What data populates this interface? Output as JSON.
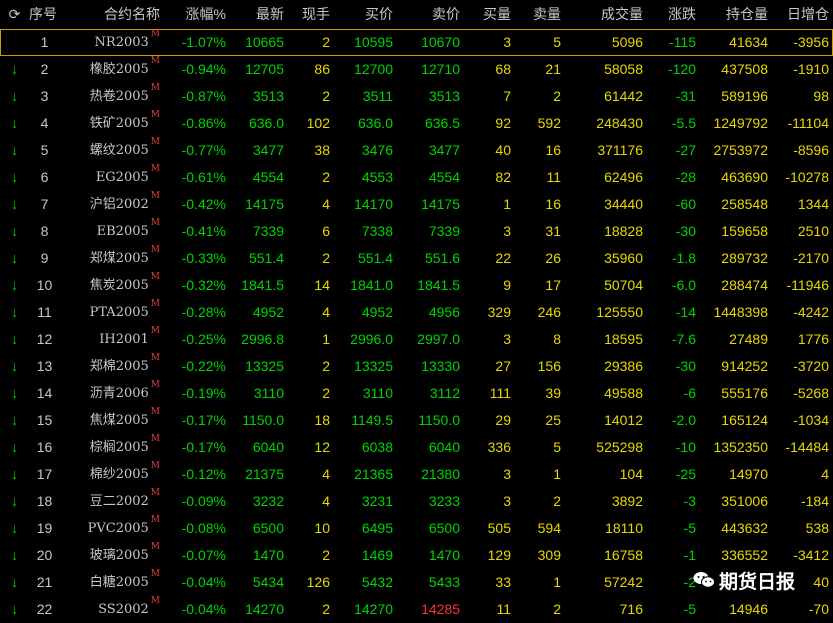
{
  "header": {
    "refresh_glyph": "⟳",
    "columns": [
      "序号",
      "合约名称",
      "涨幅%",
      "最新",
      "现手",
      "买价",
      "卖价",
      "买量",
      "卖量",
      "成交量",
      "涨跌",
      "持仓量",
      "日增仓"
    ]
  },
  "rows": [
    {
      "seq": "1",
      "name": "NR2003",
      "flag": "M",
      "pct": "-1.07%",
      "last": "10665",
      "hand": "2",
      "bid": "10595",
      "ask": "10670",
      "bidv": "3",
      "askv": "5",
      "vol": "5096",
      "chg": "-115",
      "oi": "41634",
      "doi": "-3956"
    },
    {
      "seq": "2",
      "name": "橡胶2005",
      "flag": "M",
      "pct": "-0.94%",
      "last": "12705",
      "hand": "86",
      "bid": "12700",
      "ask": "12710",
      "bidv": "68",
      "askv": "21",
      "vol": "58058",
      "chg": "-120",
      "oi": "437508",
      "doi": "-1910"
    },
    {
      "seq": "3",
      "name": "热卷2005",
      "flag": "M",
      "pct": "-0.87%",
      "last": "3513",
      "hand": "2",
      "bid": "3511",
      "ask": "3513",
      "bidv": "7",
      "askv": "2",
      "vol": "61442",
      "chg": "-31",
      "oi": "589196",
      "doi": "98"
    },
    {
      "seq": "4",
      "name": "铁矿2005",
      "flag": "M",
      "pct": "-0.86%",
      "last": "636.0",
      "hand": "102",
      "bid": "636.0",
      "ask": "636.5",
      "bidv": "92",
      "askv": "592",
      "vol": "248430",
      "chg": "-5.5",
      "oi": "1249792",
      "doi": "-11104"
    },
    {
      "seq": "5",
      "name": "螺纹2005",
      "flag": "M",
      "pct": "-0.77%",
      "last": "3477",
      "hand": "38",
      "bid": "3476",
      "ask": "3477",
      "bidv": "40",
      "askv": "16",
      "vol": "371176",
      "chg": "-27",
      "oi": "2753972",
      "doi": "-8596"
    },
    {
      "seq": "6",
      "name": "EG2005",
      "flag": "M",
      "pct": "-0.61%",
      "last": "4554",
      "hand": "2",
      "bid": "4553",
      "ask": "4554",
      "bidv": "82",
      "askv": "11",
      "vol": "62496",
      "chg": "-28",
      "oi": "463690",
      "doi": "-10278"
    },
    {
      "seq": "7",
      "name": "沪铝2002",
      "flag": "M",
      "pct": "-0.42%",
      "last": "14175",
      "hand": "4",
      "bid": "14170",
      "ask": "14175",
      "bidv": "1",
      "askv": "16",
      "vol": "34440",
      "chg": "-60",
      "oi": "258548",
      "doi": "1344"
    },
    {
      "seq": "8",
      "name": "EB2005",
      "flag": "M",
      "pct": "-0.41%",
      "last": "7339",
      "hand": "6",
      "bid": "7338",
      "ask": "7339",
      "bidv": "3",
      "askv": "31",
      "vol": "18828",
      "chg": "-30",
      "oi": "159658",
      "doi": "2510"
    },
    {
      "seq": "9",
      "name": "郑煤2005",
      "flag": "M",
      "pct": "-0.33%",
      "last": "551.4",
      "hand": "2",
      "bid": "551.4",
      "ask": "551.6",
      "bidv": "22",
      "askv": "26",
      "vol": "35960",
      "chg": "-1.8",
      "oi": "289732",
      "doi": "-2170"
    },
    {
      "seq": "10",
      "name": "焦炭2005",
      "flag": "M",
      "pct": "-0.32%",
      "last": "1841.5",
      "hand": "14",
      "bid": "1841.0",
      "ask": "1841.5",
      "bidv": "9",
      "askv": "17",
      "vol": "50704",
      "chg": "-6.0",
      "oi": "288474",
      "doi": "-11946"
    },
    {
      "seq": "11",
      "name": "PTA2005",
      "flag": "M",
      "pct": "-0.28%",
      "last": "4952",
      "hand": "4",
      "bid": "4952",
      "ask": "4956",
      "bidv": "329",
      "askv": "246",
      "vol": "125550",
      "chg": "-14",
      "oi": "1448398",
      "doi": "-4242"
    },
    {
      "seq": "12",
      "name": "IH2001",
      "flag": "M",
      "pct": "-0.25%",
      "last": "2996.8",
      "hand": "1",
      "bid": "2996.0",
      "ask": "2997.0",
      "bidv": "3",
      "askv": "8",
      "vol": "18595",
      "chg": "-7.6",
      "oi": "27489",
      "doi": "1776"
    },
    {
      "seq": "13",
      "name": "郑棉2005",
      "flag": "M",
      "pct": "-0.22%",
      "last": "13325",
      "hand": "2",
      "bid": "13325",
      "ask": "13330",
      "bidv": "27",
      "askv": "156",
      "vol": "29386",
      "chg": "-30",
      "oi": "914252",
      "doi": "-3720"
    },
    {
      "seq": "14",
      "name": "沥青2006",
      "flag": "M",
      "pct": "-0.19%",
      "last": "3110",
      "hand": "2",
      "bid": "3110",
      "ask": "3112",
      "bidv": "111",
      "askv": "39",
      "vol": "49588",
      "chg": "-6",
      "oi": "555176",
      "doi": "-5268"
    },
    {
      "seq": "15",
      "name": "焦煤2005",
      "flag": "M",
      "pct": "-0.17%",
      "last": "1150.0",
      "hand": "18",
      "bid": "1149.5",
      "ask": "1150.0",
      "bidv": "29",
      "askv": "25",
      "vol": "14012",
      "chg": "-2.0",
      "oi": "165124",
      "doi": "-1034"
    },
    {
      "seq": "16",
      "name": "棕榈2005",
      "flag": "M",
      "pct": "-0.17%",
      "last": "6040",
      "hand": "12",
      "bid": "6038",
      "ask": "6040",
      "bidv": "336",
      "askv": "5",
      "vol": "525298",
      "chg": "-10",
      "oi": "1352350",
      "doi": "-14484"
    },
    {
      "seq": "17",
      "name": "棉纱2005",
      "flag": "M",
      "pct": "-0.12%",
      "last": "21375",
      "hand": "4",
      "bid": "21365",
      "ask": "21380",
      "bidv": "3",
      "askv": "1",
      "vol": "104",
      "chg": "-25",
      "oi": "14970",
      "doi": "4"
    },
    {
      "seq": "18",
      "name": "豆二2002",
      "flag": "M",
      "pct": "-0.09%",
      "last": "3232",
      "hand": "4",
      "bid": "3231",
      "ask": "3233",
      "bidv": "3",
      "askv": "2",
      "vol": "3892",
      "chg": "-3",
      "oi": "351006",
      "doi": "-184"
    },
    {
      "seq": "19",
      "name": "PVC2005",
      "flag": "M",
      "pct": "-0.08%",
      "last": "6500",
      "hand": "10",
      "bid": "6495",
      "ask": "6500",
      "bidv": "505",
      "askv": "594",
      "vol": "18110",
      "chg": "-5",
      "oi": "443632",
      "doi": "538"
    },
    {
      "seq": "20",
      "name": "玻璃2005",
      "flag": "M",
      "pct": "-0.07%",
      "last": "1470",
      "hand": "2",
      "bid": "1469",
      "ask": "1470",
      "bidv": "129",
      "askv": "309",
      "vol": "16758",
      "chg": "-1",
      "oi": "336552",
      "doi": "-3412"
    },
    {
      "seq": "21",
      "name": "白糖2005",
      "flag": "M",
      "pct": "-0.04%",
      "last": "5434",
      "hand": "126",
      "bid": "5432",
      "ask": "5433",
      "bidv": "33",
      "askv": "1",
      "vol": "57242",
      "chg": "-2",
      "oi": "",
      "doi": "40"
    },
    {
      "seq": "22",
      "name": "SS2002",
      "flag": "M",
      "pct": "-0.04%",
      "last": "14270",
      "hand": "2",
      "bid": "14270",
      "ask": "14285",
      "bidv": "11",
      "askv": "2",
      "vol": "716",
      "chg": "-5",
      "oi": "14946",
      "doi": "-70"
    }
  ],
  "watermark": {
    "text": "期货日报"
  },
  "colors": {
    "up_arrow": "#00c800",
    "negative": "#00d400",
    "neutral": "#e8d800",
    "ask_up": "#ff3030"
  }
}
